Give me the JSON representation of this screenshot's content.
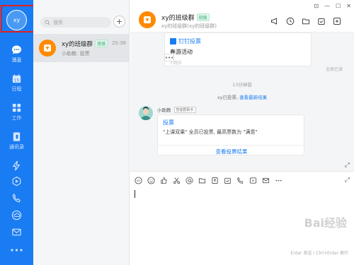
{
  "profile": {
    "initials": "xy"
  },
  "rail": [
    {
      "label": "消息",
      "icon": "message-icon"
    },
    {
      "label": "日程",
      "icon": "calendar-icon"
    },
    {
      "label": "工作",
      "icon": "work-grid-icon"
    },
    {
      "label": "通讯录",
      "icon": "contacts-icon"
    }
  ],
  "sidebar": {
    "search_placeholder": "搜索"
  },
  "conversation": {
    "title": "xy的班级群",
    "badge": "班级",
    "preview": "小助教: 投票",
    "time": "20:38"
  },
  "header": {
    "title": "xy的班级群",
    "badge": "班级",
    "subtitle": "xy的班级群(xy的班级群)"
  },
  "messages": {
    "card1": {
      "app": "钉钉投票",
      "body": "春游活动",
      "mini": "小程序"
    },
    "all_read": "全部已读",
    "timestamp": "13分钟前",
    "sys_text": "xy已投票, ",
    "sys_link": "查看最新结果",
    "sender": "小助教",
    "sender_role": "智能群助手",
    "card2": {
      "title": "投票",
      "body": "\"上课双果\" 全员已投票, 最高票数为 \"满意\"",
      "link": "查看投票结果"
    }
  },
  "input": {
    "hint": "Enter 发送 / Ctrl+Enter 换行"
  },
  "watermark": "Bai经验",
  "colors": {
    "rail": "#1a7cf2",
    "accent": "#1a7cf2",
    "group_avatar": "#ff8a00",
    "highlight_box": "#e02020"
  }
}
